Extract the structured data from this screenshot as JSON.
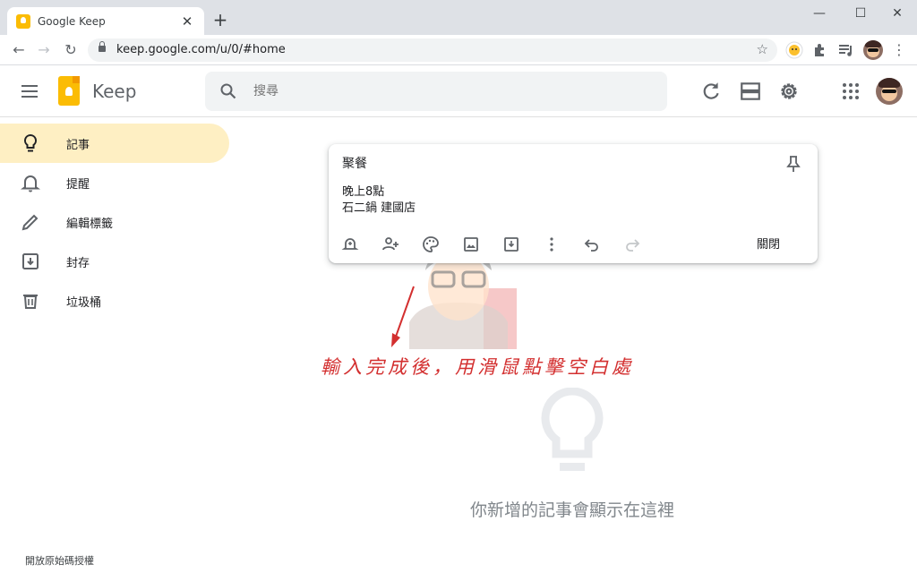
{
  "browser": {
    "tab_title": "Google Keep",
    "tab_close": "✕",
    "new_tab": "+",
    "url": "keep.google.com/u/0/#home",
    "window_controls": [
      "—",
      "☐",
      "✕"
    ]
  },
  "app": {
    "name": "Keep",
    "search_placeholder": "搜尋"
  },
  "sidebar": {
    "items": [
      {
        "label": "記事",
        "icon": "lightbulb-icon",
        "active": true
      },
      {
        "label": "提醒",
        "icon": "bell-icon",
        "active": false
      },
      {
        "label": "編輯標籤",
        "icon": "pencil-icon",
        "active": false
      },
      {
        "label": "封存",
        "icon": "archive-icon",
        "active": false
      },
      {
        "label": "垃圾桶",
        "icon": "trash-icon",
        "active": false
      }
    ],
    "license": "開放原始碼授權"
  },
  "note": {
    "title": "聚餐",
    "lines": [
      "晚上8點",
      "石二鍋 建國店"
    ],
    "close_label": "關閉"
  },
  "annotation": "輸入完成後，用滑鼠點擊空白處",
  "empty_state": {
    "message": "你新增的記事會顯示在這裡"
  },
  "colors": {
    "accent": "#fbbc04",
    "active_bg": "#feefc3",
    "annotation": "#d32f2f"
  }
}
